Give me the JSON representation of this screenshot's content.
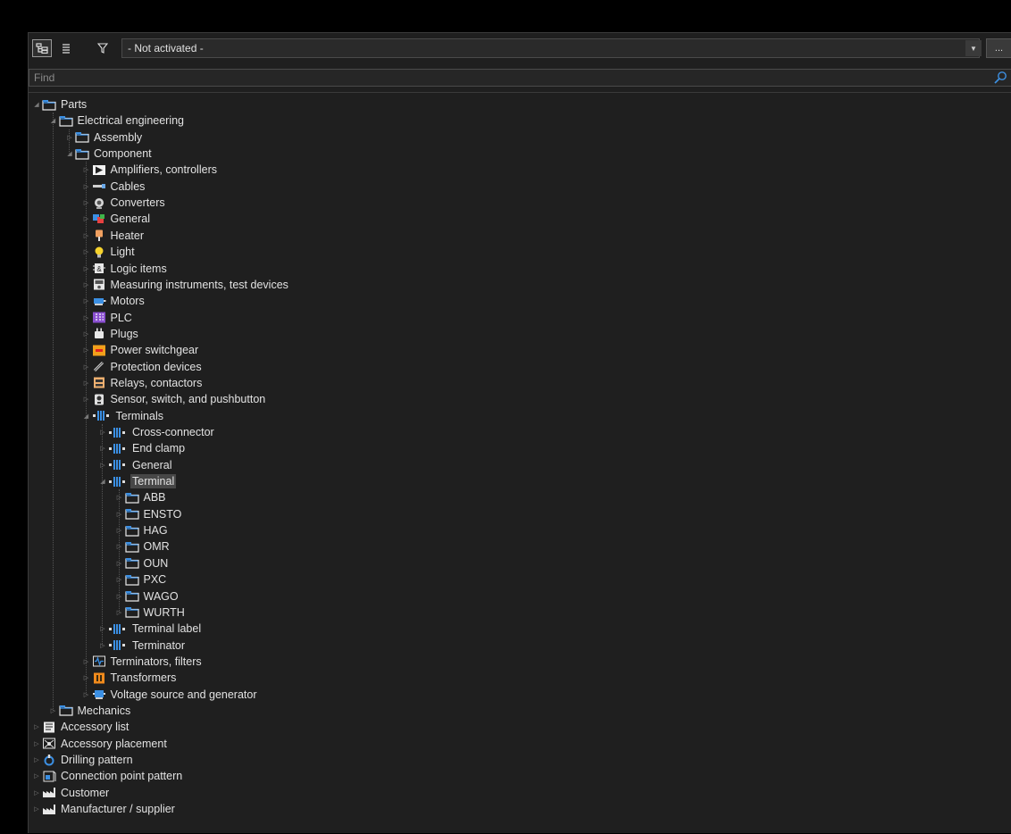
{
  "toolbar": {
    "filter_value": "- Not activated -",
    "more_label": "..."
  },
  "find": {
    "placeholder": "Find"
  },
  "tree": [
    {
      "label": "Parts",
      "level": 0,
      "expanded": true,
      "icon": "folder-icon"
    },
    {
      "label": "Electrical engineering",
      "level": 1,
      "expanded": true,
      "icon": "folder-icon"
    },
    {
      "label": "Assembly",
      "level": 2,
      "expanded": false,
      "icon": "folder-icon"
    },
    {
      "label": "Component",
      "level": 2,
      "expanded": true,
      "icon": "folder-icon"
    },
    {
      "label": "Amplifiers, controllers",
      "level": 3,
      "expanded": false,
      "icon": "amplifier-icon"
    },
    {
      "label": "Cables",
      "level": 3,
      "expanded": false,
      "icon": "cable-icon"
    },
    {
      "label": "Converters",
      "level": 3,
      "expanded": false,
      "icon": "converter-icon"
    },
    {
      "label": "General",
      "level": 3,
      "expanded": false,
      "icon": "general-icon"
    },
    {
      "label": "Heater",
      "level": 3,
      "expanded": false,
      "icon": "heater-icon"
    },
    {
      "label": "Light",
      "level": 3,
      "expanded": false,
      "icon": "light-bulb-icon"
    },
    {
      "label": "Logic items",
      "level": 3,
      "expanded": false,
      "icon": "logic-icon"
    },
    {
      "label": "Measuring instruments, test devices",
      "level": 3,
      "expanded": false,
      "icon": "meter-icon"
    },
    {
      "label": "Motors",
      "level": 3,
      "expanded": false,
      "icon": "motor-icon"
    },
    {
      "label": "PLC",
      "level": 3,
      "expanded": false,
      "icon": "plc-icon"
    },
    {
      "label": "Plugs",
      "level": 3,
      "expanded": false,
      "icon": "plug-icon"
    },
    {
      "label": "Power switchgear",
      "level": 3,
      "expanded": false,
      "icon": "switchgear-icon"
    },
    {
      "label": "Protection devices",
      "level": 3,
      "expanded": false,
      "icon": "fuse-icon"
    },
    {
      "label": "Relays, contactors",
      "level": 3,
      "expanded": false,
      "icon": "relay-icon"
    },
    {
      "label": "Sensor, switch, and pushbutton",
      "level": 3,
      "expanded": false,
      "icon": "sensor-icon"
    },
    {
      "label": "Terminals",
      "level": 3,
      "expanded": true,
      "icon": "terminal-icon"
    },
    {
      "label": "Cross-connector",
      "level": 4,
      "expanded": false,
      "icon": "terminal-icon"
    },
    {
      "label": "End clamp",
      "level": 4,
      "expanded": false,
      "icon": "terminal-icon"
    },
    {
      "label": "General",
      "level": 4,
      "expanded": false,
      "icon": "terminal-icon"
    },
    {
      "label": "Terminal",
      "level": 4,
      "expanded": true,
      "icon": "terminal-icon",
      "selected": true
    },
    {
      "label": "ABB",
      "level": 5,
      "expanded": false,
      "icon": "folder-icon"
    },
    {
      "label": "ENSTO",
      "level": 5,
      "expanded": false,
      "icon": "folder-icon"
    },
    {
      "label": "HAG",
      "level": 5,
      "expanded": false,
      "icon": "folder-icon"
    },
    {
      "label": "OMR",
      "level": 5,
      "expanded": false,
      "icon": "folder-icon"
    },
    {
      "label": "OUN",
      "level": 5,
      "expanded": false,
      "icon": "folder-icon"
    },
    {
      "label": "PXC",
      "level": 5,
      "expanded": false,
      "icon": "folder-icon"
    },
    {
      "label": "WAGO",
      "level": 5,
      "expanded": false,
      "icon": "folder-icon"
    },
    {
      "label": "WURTH",
      "level": 5,
      "expanded": false,
      "icon": "folder-icon"
    },
    {
      "label": "Terminal label",
      "level": 4,
      "expanded": false,
      "icon": "terminal-icon"
    },
    {
      "label": "Terminator",
      "level": 4,
      "expanded": false,
      "icon": "terminal-icon"
    },
    {
      "label": "Terminators, filters",
      "level": 3,
      "expanded": false,
      "icon": "filter-icon"
    },
    {
      "label": "Transformers",
      "level": 3,
      "expanded": false,
      "icon": "transformer-icon"
    },
    {
      "label": "Voltage source and generator",
      "level": 3,
      "expanded": false,
      "icon": "generator-icon"
    },
    {
      "label": "Mechanics",
      "level": 1,
      "expanded": false,
      "icon": "folder-icon"
    },
    {
      "label": "Accessory list",
      "level": 0,
      "expanded": false,
      "icon": "accessory-list-icon"
    },
    {
      "label": "Accessory placement",
      "level": 0,
      "expanded": false,
      "icon": "accessory-placement-icon"
    },
    {
      "label": "Drilling pattern",
      "level": 0,
      "expanded": false,
      "icon": "drilling-icon"
    },
    {
      "label": "Connection point pattern",
      "level": 0,
      "expanded": false,
      "icon": "connection-point-icon"
    },
    {
      "label": "Customer",
      "level": 0,
      "expanded": false,
      "icon": "factory-icon"
    },
    {
      "label": "Manufacturer / supplier",
      "level": 0,
      "expanded": false,
      "icon": "factory-icon"
    }
  ]
}
